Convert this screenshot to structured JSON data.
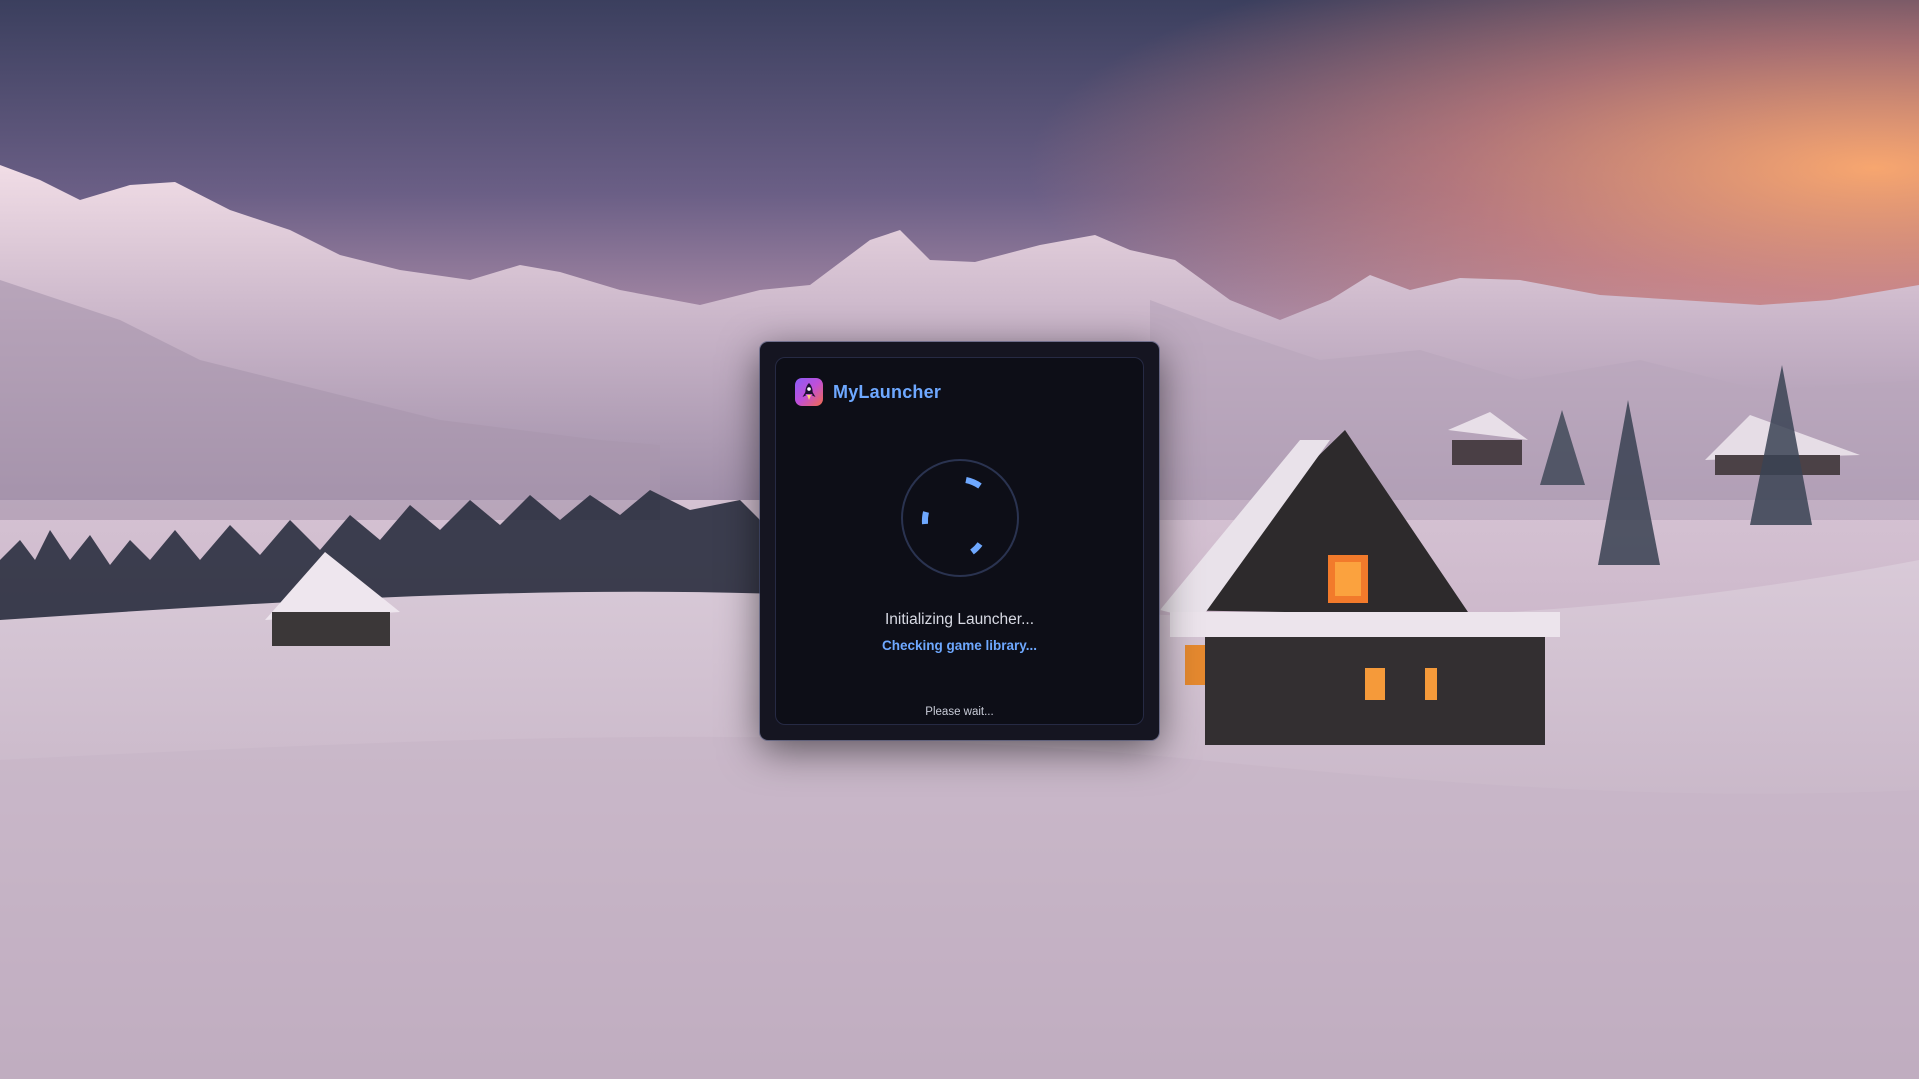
{
  "app": {
    "name": "MyLauncher",
    "logo_icon": "rocket-icon",
    "accent_color": "#6ea8ff"
  },
  "splash": {
    "status_title": "Initializing Launcher...",
    "status_detail": "Checking game library...",
    "footer_note": "Please wait...",
    "spinner_icon": "loading-spinner-icon"
  },
  "colors": {
    "panel_background": "#0d0e17",
    "panel_border": "#262a44",
    "spinner_color": "#6ea8ff"
  }
}
